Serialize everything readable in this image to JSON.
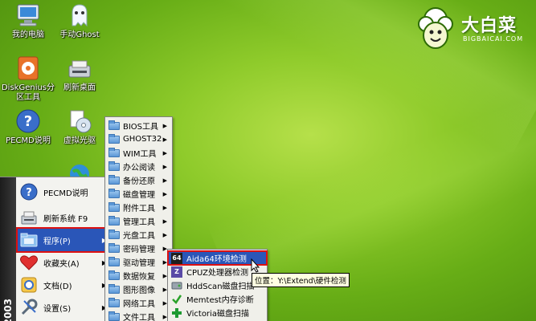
{
  "desktop": {
    "icons": [
      {
        "label": "我的电脑",
        "icon": "computer-icon"
      },
      {
        "label": "手动Ghost",
        "icon": "ghost-icon"
      },
      {
        "label": "DiskGenius分\n区工具",
        "icon": "diskgenius-icon"
      },
      {
        "label": "刷新桌面",
        "icon": "refresh-desktop-icon"
      },
      {
        "label": "PECMD说明",
        "icon": "help-icon"
      },
      {
        "label": "虚拟光驱",
        "icon": "virtual-drive-icon"
      }
    ]
  },
  "logo": {
    "title": "大白菜",
    "subtitle": "BIGBAICAI.COM"
  },
  "start_menu": {
    "side_label": "2003",
    "items": [
      {
        "label": "PECMD说明",
        "icon": "help-icon"
      },
      {
        "label": "刷新系统 F9",
        "icon": "refresh-icon"
      },
      {
        "label": "程序(P)",
        "icon": "programs-folder-icon",
        "has_submenu": true
      },
      {
        "label": "收藏夹(A)",
        "icon": "heart-icon",
        "has_submenu": true
      },
      {
        "label": "文档(D)",
        "icon": "documents-icon",
        "has_submenu": true
      },
      {
        "label": "设置(S)",
        "icon": "settings-icon",
        "has_submenu": true
      }
    ]
  },
  "programs_menu": {
    "items": [
      "BIOS工具",
      "GHOST32",
      "WIM工具",
      "办公阅读",
      "备份还原",
      "磁盘管理",
      "附件工具",
      "管理工具",
      "光盘工具",
      "密码管理",
      "驱动管理",
      "数据恢复",
      "图形图像",
      "网络工具",
      "文件工具"
    ]
  },
  "disk_menu": {
    "items": [
      {
        "label": "Aida64环境检测",
        "icon": "aida64-icon",
        "badge": "64"
      },
      {
        "label": "CPUZ处理器检测",
        "icon": "cpuz-icon",
        "badge": "Z"
      },
      {
        "label": "HddScan磁盘扫描",
        "icon": "hddscan-icon"
      },
      {
        "label": "Memtest内存诊断",
        "icon": "memtest-icon"
      },
      {
        "label": "Victoria磁盘扫描",
        "icon": "victoria-icon"
      }
    ]
  },
  "tooltip": {
    "text": "位置：Y:\\Extend\\硬件检测"
  }
}
